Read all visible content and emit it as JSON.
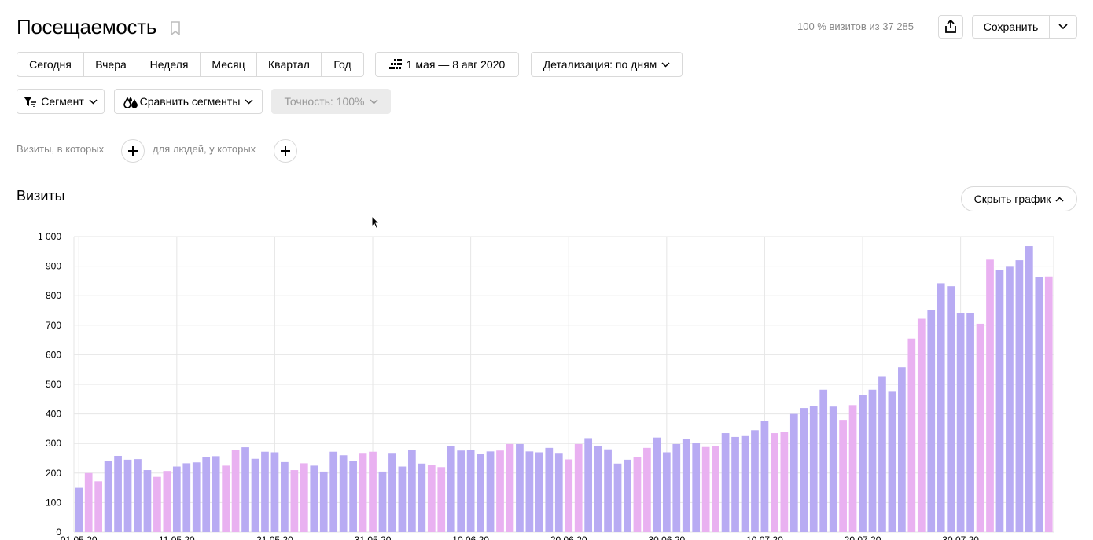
{
  "header": {
    "title": "Посещаемость",
    "visits_info": "100 % визитов из 37 285",
    "save_label": "Сохранить"
  },
  "periods": [
    "Сегодня",
    "Вчера",
    "Неделя",
    "Месяц",
    "Квартал",
    "Год"
  ],
  "date_range": "1 мая — 8 авг 2020",
  "detail": "Детализация: по дням",
  "segment": "Сегмент",
  "compare": "Сравнить сегменты",
  "accuracy": "Точность: 100%",
  "filters": {
    "visits_where": "Визиты, в которых",
    "people_where": "для людей, у которых"
  },
  "section": {
    "title": "Визиты",
    "hide_chart": "Скрыть график"
  },
  "chart_data": {
    "type": "bar",
    "ylim": [
      0,
      1000
    ],
    "yticks": [
      0,
      100,
      200,
      300,
      400,
      500,
      600,
      700,
      800,
      900,
      1000
    ],
    "ytick_labels": [
      "0",
      "100",
      "200",
      "300",
      "400",
      "500",
      "600",
      "700",
      "800",
      "900",
      "1 000"
    ],
    "x_start": "2020-05-01",
    "xticks": [
      "01.05.20",
      "11.05.20",
      "21.05.20",
      "31.05.20",
      "10.06.20",
      "20.06.20",
      "30.06.20",
      "10.07.20",
      "20.07.20",
      "30.07.20"
    ],
    "values": [
      150,
      200,
      172,
      240,
      258,
      245,
      247,
      210,
      187,
      207,
      222,
      233,
      236,
      254,
      257,
      225,
      278,
      287,
      248,
      272,
      270,
      237,
      210,
      233,
      225,
      205,
      272,
      260,
      240,
      268,
      272,
      205,
      268,
      222,
      278,
      232,
      226,
      220,
      290,
      276,
      278,
      265,
      273,
      276,
      298,
      298,
      273,
      270,
      285,
      268,
      246,
      298,
      318,
      292,
      280,
      232,
      245,
      253,
      285,
      320,
      270,
      298,
      315,
      302,
      288,
      292,
      335,
      322,
      325,
      345,
      375,
      335,
      340,
      400,
      420,
      428,
      482,
      425,
      380,
      430,
      465,
      482,
      528,
      475,
      558,
      655,
      722,
      752,
      842,
      832,
      742,
      742,
      705,
      922,
      888,
      898,
      920,
      968,
      862,
      865
    ],
    "colors": {
      "weekday": "#b8abf3",
      "weekend": "#e9b1f1",
      "grid": "#e6e6e6"
    }
  }
}
